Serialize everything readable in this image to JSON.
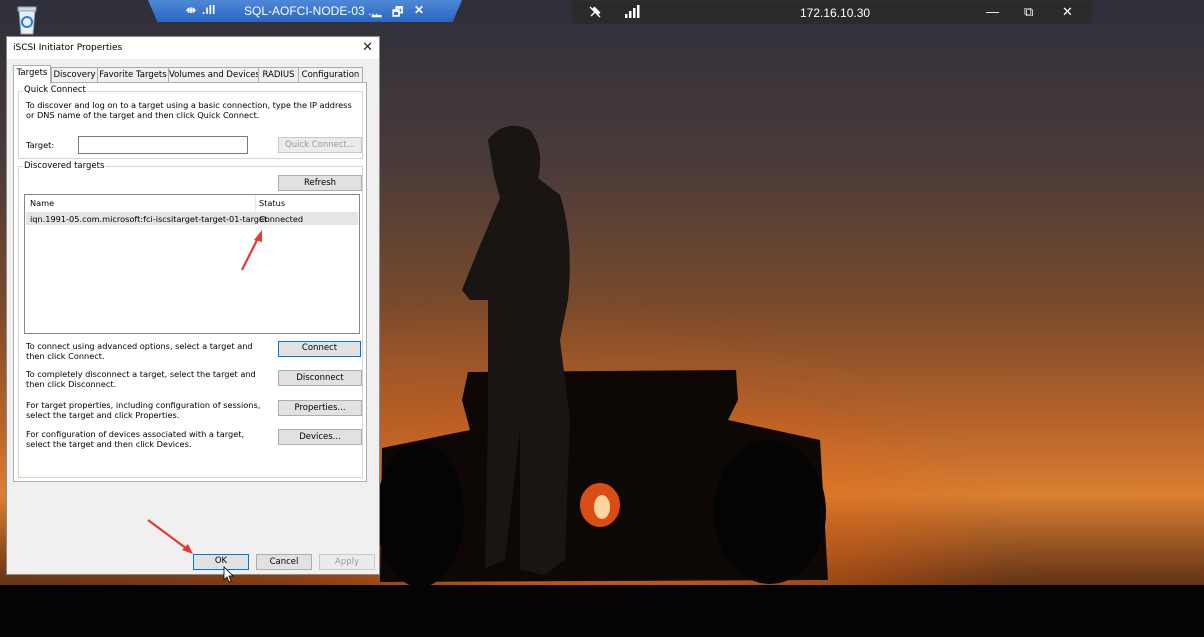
{
  "remote_session_bar": {
    "title": "SQL-AOFCI-NODE-03 ...",
    "pin_icon": "⇹",
    "signal_icon": ".ıll",
    "minimize": "▁",
    "restore": "🗗",
    "close": "✕"
  },
  "connection_bar": {
    "ip": "172.16.10.30",
    "unpin_icon": "pin-off-icon",
    "signal_icon": "signal-icon",
    "minimize": "—",
    "restore": "⧉",
    "close": "✕"
  },
  "dialog": {
    "title": "iSCSI Initiator Properties",
    "close": "✕",
    "tabs": [
      "Targets",
      "Discovery",
      "Favorite Targets",
      "Volumes and Devices",
      "RADIUS",
      "Configuration"
    ],
    "quick_connect": {
      "label": "Quick Connect",
      "description": "To discover and log on to a target using a basic connection, type the IP address or DNS name of the target and then click Quick Connect.",
      "target_label": "Target:",
      "target_value": "",
      "quick_connect_button": "Quick Connect..."
    },
    "discovered": {
      "label": "Discovered targets",
      "refresh_button": "Refresh",
      "columns": [
        "Name",
        "Status"
      ],
      "rows": [
        {
          "name": "iqn.1991-05.com.microsoft:fci-iscsitarget-target-01-target",
          "status": "Connected"
        }
      ]
    },
    "actions": [
      {
        "text": "To connect using advanced options, select a target and then click Connect.",
        "button": "Connect"
      },
      {
        "text": "To completely disconnect a target, select the target and then click Disconnect.",
        "button": "Disconnect"
      },
      {
        "text": "For target properties, including configuration of sessions, select the target and click Properties.",
        "button": "Properties..."
      },
      {
        "text": "For configuration of devices associated with a target, select the target and then click Devices.",
        "button": "Devices..."
      }
    ],
    "footer": {
      "ok": "OK",
      "cancel": "Cancel",
      "apply": "Apply"
    }
  },
  "colors": {
    "annotation_arrow": "#e53935",
    "title_bar_blue": "#2a66c2",
    "focus_blue": "#0078d7"
  }
}
